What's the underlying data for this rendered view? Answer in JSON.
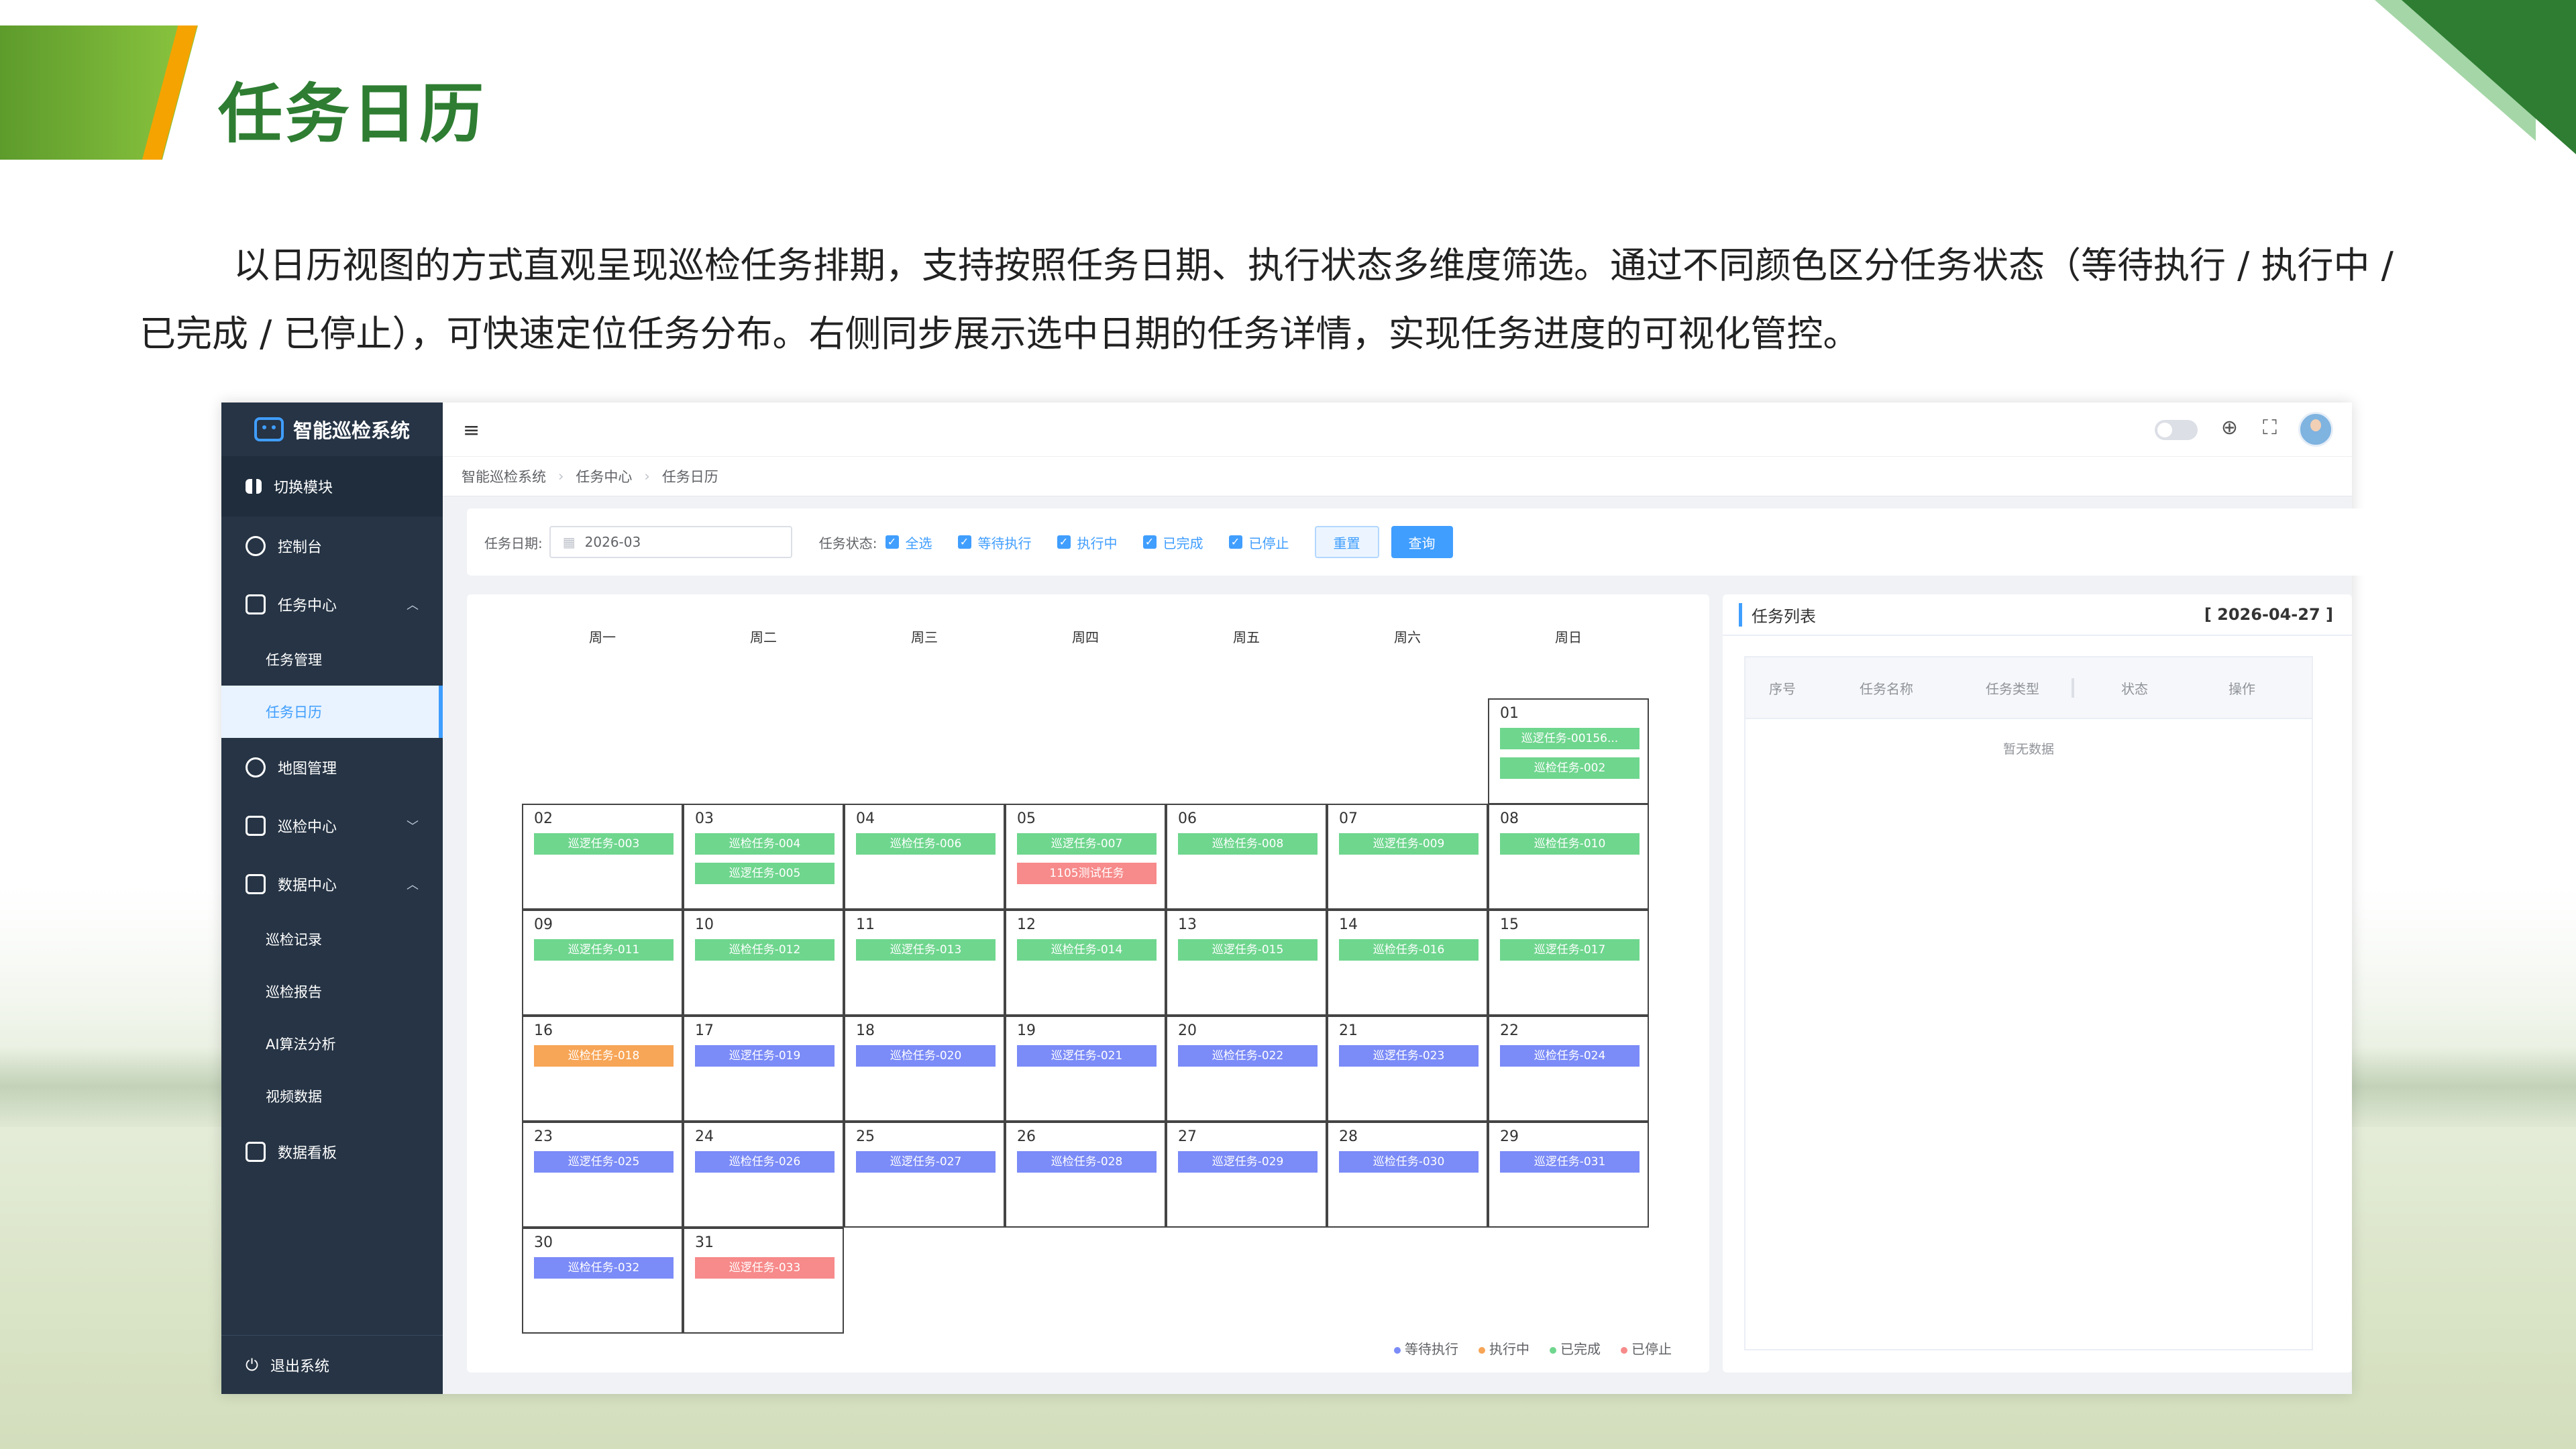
{
  "slide": {
    "title": "任务日历",
    "description": "以日历视图的方式直观呈现巡检任务排期，支持按照任务日期、执行状态多维度筛选。通过不同颜色区分任务状态（等待执行 / 执行中 / 已完成 / 已停止），可快速定位任务分布。右侧同步展示选中日期的任务详情，实现任务进度的可视化管控。"
  },
  "app": {
    "logo": "智能巡检系统",
    "sidebar": {
      "switch": "切换模块",
      "console": "控制台",
      "task_center": "任务中心",
      "task_manage": "任务管理",
      "task_calendar": "任务日历",
      "map_manage": "地图管理",
      "inspect_center": "巡检中心",
      "data_center": "数据中心",
      "inspect_record": "巡检记录",
      "inspect_report": "巡检报告",
      "ai_analysis": "AI算法分析",
      "video_data": "视频数据",
      "dashboard": "数据看板",
      "logout": "退出系统"
    },
    "breadcrumb": [
      "智能巡检系统",
      "任务中心",
      "任务日历"
    ],
    "filter": {
      "date_label": "任务日期:",
      "date_value": "2026-03",
      "status_label": "任务状态:",
      "checks": [
        "全选",
        "等待执行",
        "执行中",
        "已完成",
        "已停止"
      ],
      "reset": "重置",
      "query": "查询"
    },
    "weekdays": [
      "周一",
      "周二",
      "周三",
      "周四",
      "周五",
      "周六",
      "周日"
    ],
    "days": [
      {
        "d": "01",
        "tasks": [
          {
            "t": "巡逻任务-00156...",
            "c": "g"
          },
          {
            "t": "巡检任务-002",
            "c": "g"
          }
        ]
      },
      {
        "d": "02",
        "tasks": [
          {
            "t": "巡逻任务-003",
            "c": "g"
          }
        ]
      },
      {
        "d": "03",
        "tasks": [
          {
            "t": "巡检任务-004",
            "c": "g"
          },
          {
            "t": "巡逻任务-005",
            "c": "g"
          }
        ]
      },
      {
        "d": "04",
        "tasks": [
          {
            "t": "巡检任务-006",
            "c": "g"
          }
        ]
      },
      {
        "d": "05",
        "tasks": [
          {
            "t": "巡逻任务-007",
            "c": "g"
          },
          {
            "t": "1105测试任务",
            "c": "r"
          }
        ]
      },
      {
        "d": "06",
        "tasks": [
          {
            "t": "巡检任务-008",
            "c": "g"
          }
        ]
      },
      {
        "d": "07",
        "tasks": [
          {
            "t": "巡逻任务-009",
            "c": "g"
          }
        ]
      },
      {
        "d": "08",
        "tasks": [
          {
            "t": "巡检任务-010",
            "c": "g"
          }
        ]
      },
      {
        "d": "09",
        "tasks": [
          {
            "t": "巡逻任务-011",
            "c": "g"
          }
        ]
      },
      {
        "d": "10",
        "tasks": [
          {
            "t": "巡检任务-012",
            "c": "g"
          }
        ]
      },
      {
        "d": "11",
        "tasks": [
          {
            "t": "巡逻任务-013",
            "c": "g"
          }
        ]
      },
      {
        "d": "12",
        "tasks": [
          {
            "t": "巡检任务-014",
            "c": "g"
          }
        ]
      },
      {
        "d": "13",
        "tasks": [
          {
            "t": "巡逻任务-015",
            "c": "g"
          }
        ]
      },
      {
        "d": "14",
        "tasks": [
          {
            "t": "巡检任务-016",
            "c": "g"
          }
        ]
      },
      {
        "d": "15",
        "tasks": [
          {
            "t": "巡逻任务-017",
            "c": "g"
          }
        ]
      },
      {
        "d": "16",
        "tasks": [
          {
            "t": "巡检任务-018",
            "c": "o"
          }
        ]
      },
      {
        "d": "17",
        "tasks": [
          {
            "t": "巡逻任务-019",
            "c": "b"
          }
        ]
      },
      {
        "d": "18",
        "tasks": [
          {
            "t": "巡检任务-020",
            "c": "b"
          }
        ]
      },
      {
        "d": "19",
        "tasks": [
          {
            "t": "巡逻任务-021",
            "c": "b"
          }
        ]
      },
      {
        "d": "20",
        "tasks": [
          {
            "t": "巡检任务-022",
            "c": "b"
          }
        ]
      },
      {
        "d": "21",
        "tasks": [
          {
            "t": "巡逻任务-023",
            "c": "b"
          }
        ]
      },
      {
        "d": "22",
        "tasks": [
          {
            "t": "巡检任务-024",
            "c": "b"
          }
        ]
      },
      {
        "d": "23",
        "tasks": [
          {
            "t": "巡逻任务-025",
            "c": "b"
          }
        ]
      },
      {
        "d": "24",
        "tasks": [
          {
            "t": "巡检任务-026",
            "c": "b"
          }
        ]
      },
      {
        "d": "25",
        "tasks": [
          {
            "t": "巡逻任务-027",
            "c": "b"
          }
        ]
      },
      {
        "d": "26",
        "tasks": [
          {
            "t": "巡检任务-028",
            "c": "b"
          }
        ]
      },
      {
        "d": "27",
        "tasks": [
          {
            "t": "巡逻任务-029",
            "c": "b"
          }
        ]
      },
      {
        "d": "28",
        "tasks": [
          {
            "t": "巡检任务-030",
            "c": "b"
          }
        ]
      },
      {
        "d": "29",
        "tasks": [
          {
            "t": "巡逻任务-031",
            "c": "b"
          }
        ]
      },
      {
        "d": "30",
        "tasks": [
          {
            "t": "巡检任务-032",
            "c": "b"
          }
        ]
      },
      {
        "d": "31",
        "tasks": [
          {
            "t": "巡逻任务-033",
            "c": "r"
          }
        ]
      }
    ],
    "legend": [
      "等待执行",
      "执行中",
      "已完成",
      "已停止"
    ],
    "legend_colors": [
      "#7b8bf7",
      "#f7a556",
      "#6fd68e",
      "#f78a8a"
    ],
    "task_list": {
      "title": "任务列表",
      "date": "[ 2026-04-27 ]",
      "columns": [
        "序号",
        "任务名称",
        "任务类型",
        "状态",
        "操作"
      ],
      "empty": "暂无数据"
    }
  }
}
